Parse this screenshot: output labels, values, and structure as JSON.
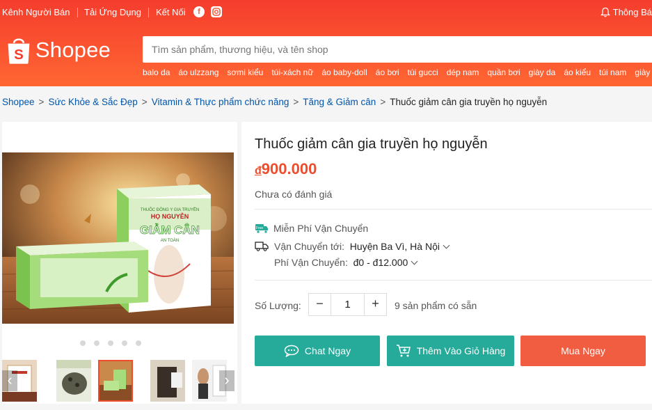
{
  "topbar": {
    "seller_channel": "Kênh Người Bán",
    "download_app": "Tải Ứng Dụng",
    "connect": "Kết Nối",
    "facebook_glyph": "f",
    "notifications": "Thông Bá"
  },
  "logo": {
    "text": "Shopee",
    "bag_letter": "S"
  },
  "search": {
    "placeholder": "Tìm sản phẩm, thương hiệu, và tên shop"
  },
  "keywords": [
    "balo da",
    "áo ulzzang",
    "sơmi kiểu",
    "túi-xách nữ",
    "áo baby-doll",
    "áo bơi",
    "túi gucci",
    "dép nam",
    "quần bơi",
    "giày da",
    "áo kiểu",
    "túi nam",
    "giày"
  ],
  "breadcrumb": [
    "Shopee",
    "Sức Khỏe & Sắc Đẹp",
    "Vitamin & Thực phẩm chức năng",
    "Tăng & Giảm cân",
    "Thuốc giảm cân gia truyền họ nguyễn"
  ],
  "product": {
    "title": "Thuốc giảm cân gia truyền họ nguyễn",
    "currency": "đ",
    "price": "900.000",
    "rating_text": "Chưa có đánh giá",
    "free_shipping": "Miễn Phí Vận Chuyển",
    "free_badge": "Free",
    "ship_to_label": "Vận Chuyển tới:",
    "ship_to_value": "Huyện Ba Vì, Hà Nội",
    "ship_fee_label": "Phí Vận Chuyển:",
    "ship_fee_value": "đ0 - đ12.000",
    "quantity_label": "Số Lượng:",
    "quantity": "1",
    "stock": "9 sản phẩm có sẵn",
    "box_text_1": "THUỐC ĐÔNG Y GIA TRUYỀN",
    "box_text_2": "HỌ NGUYỄN",
    "box_text_3": "GIẢM CÂN",
    "box_text_4": "AN TOÀN"
  },
  "actions": {
    "chat": "Chat Ngay",
    "add_to_cart": "Thêm Vào Giỏ Hàng",
    "buy_now": "Mua Ngay"
  },
  "colors": {
    "brand": "#ee4d2d",
    "teal": "#26aa99",
    "link": "#0055aa"
  },
  "icons": [
    "bell-icon",
    "facebook-icon",
    "instagram-icon",
    "free-shipping-icon",
    "truck-icon",
    "chat-icon",
    "cart-plus-icon",
    "chevron-left-icon",
    "chevron-right-icon"
  ],
  "gallery": {
    "selected_thumb": 3,
    "thumb_count": 6,
    "dot_count": 5
  }
}
